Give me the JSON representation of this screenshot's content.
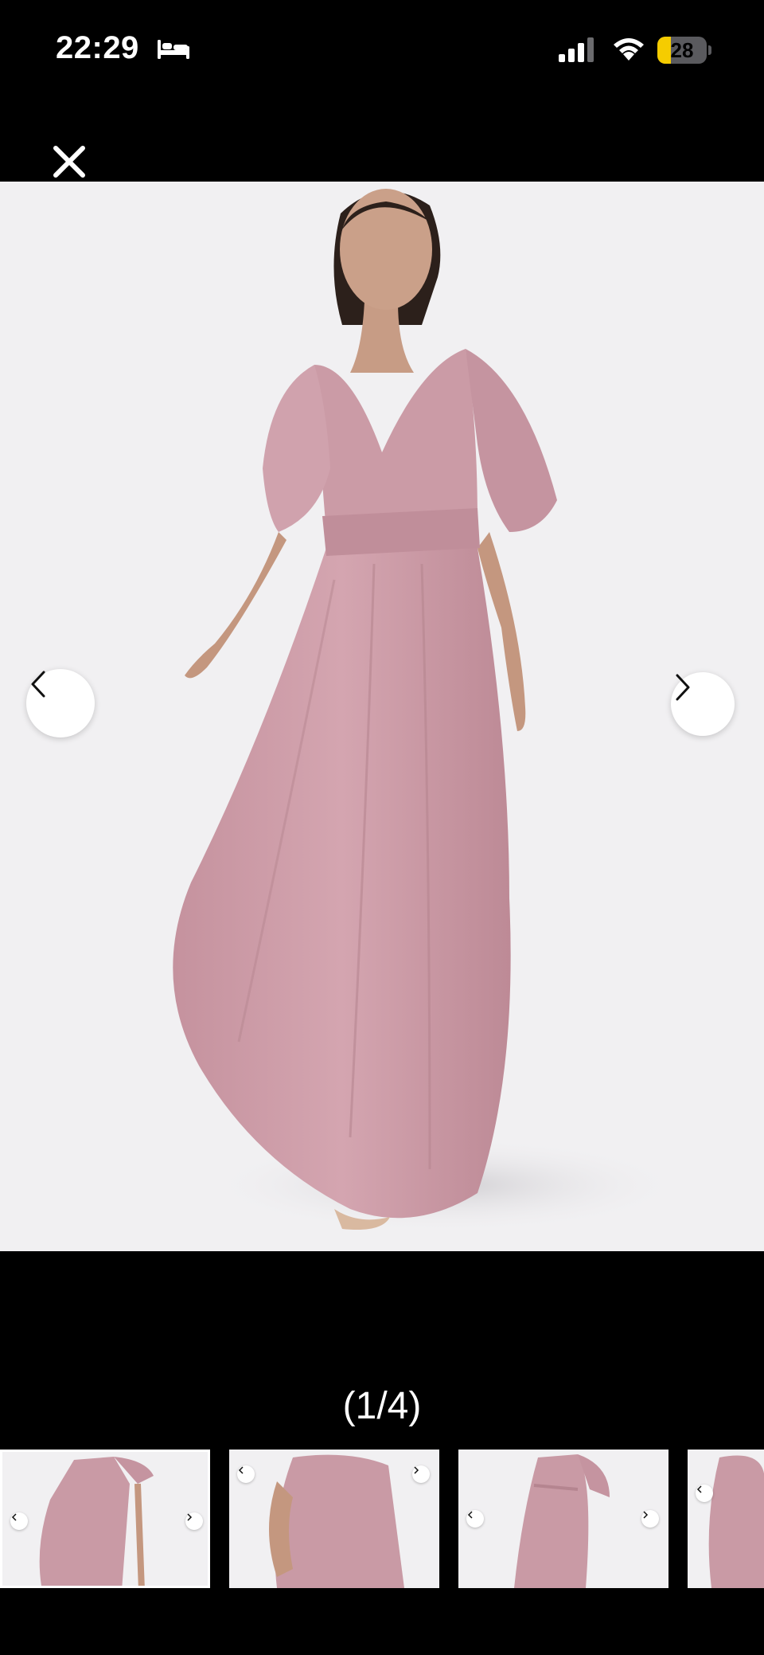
{
  "status_bar": {
    "time": "22:29",
    "battery_level": "28",
    "battery_fraction": 0.28,
    "icons": [
      "sleep-icon",
      "signal-icon",
      "wifi-icon",
      "battery-icon"
    ]
  },
  "viewer": {
    "close_icon": "close-icon",
    "prev_icon": "chevron-left-icon",
    "next_icon": "chevron-right-icon",
    "counter": "(1/4)",
    "current_index": 1,
    "total": 4
  },
  "colors": {
    "background": "#000000",
    "image_background": "#f1f0f2",
    "dress": "#c99aa5",
    "battery_fill": "#f5cc00"
  }
}
